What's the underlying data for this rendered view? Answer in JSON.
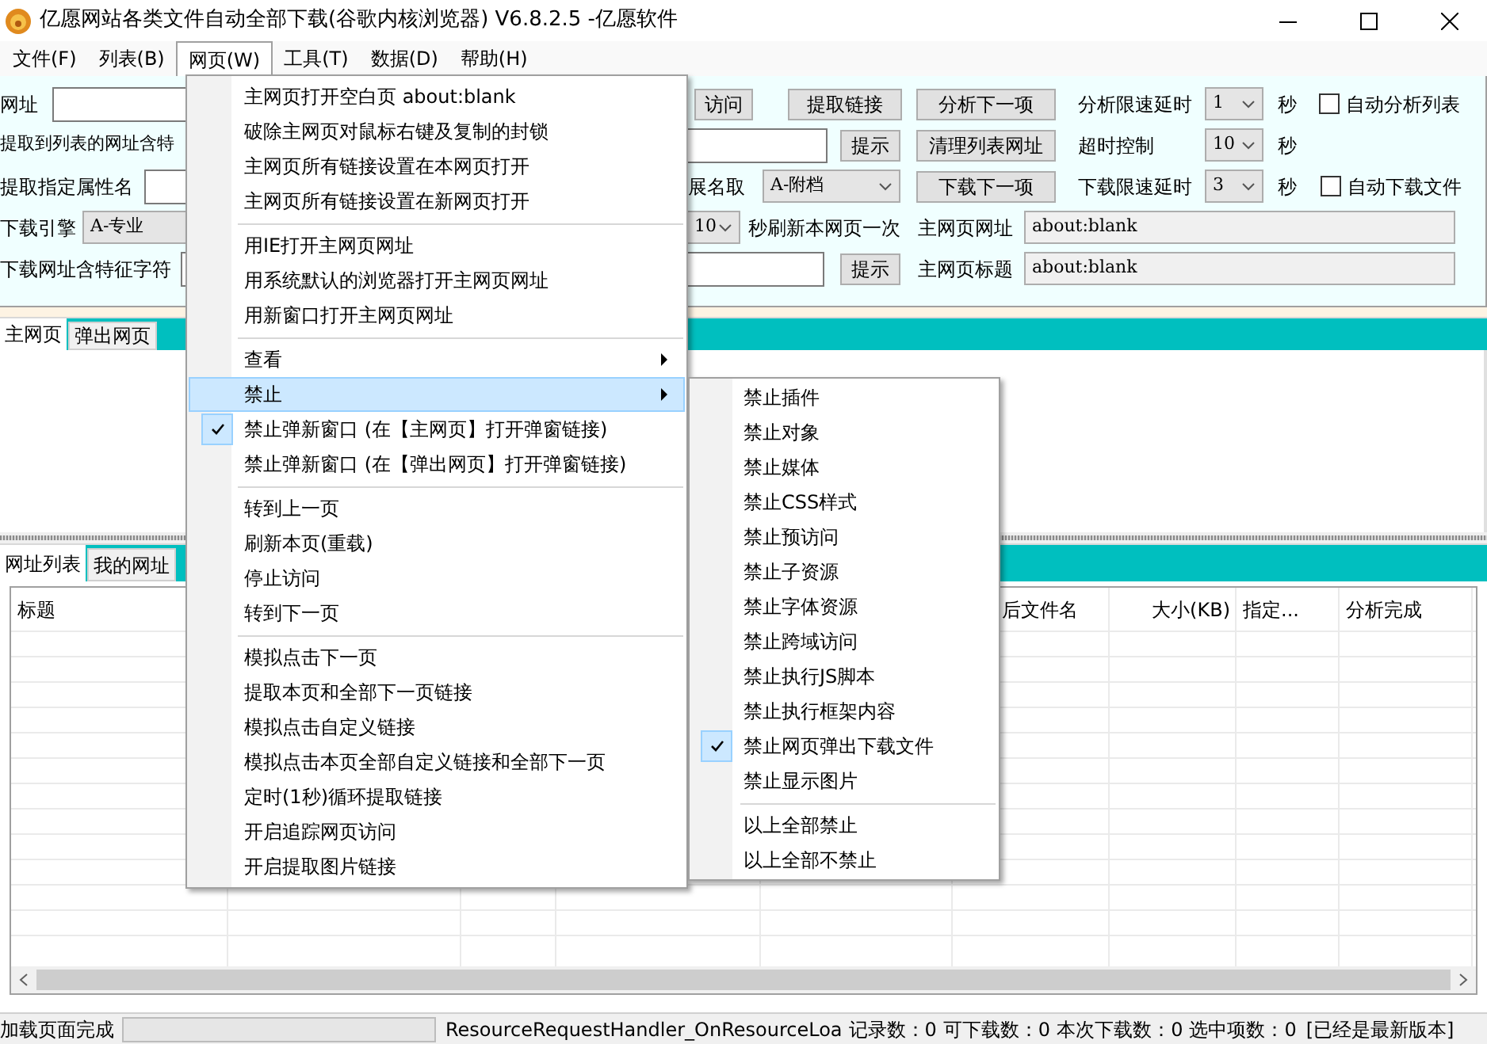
{
  "window": {
    "title": "亿愿网站各类文件自动全部下载(谷歌内核浏览器) V6.8.2.5 -亿愿软件"
  },
  "menu_bar": [
    {
      "label": "文件(F)",
      "selected": false
    },
    {
      "label": "列表(B)",
      "selected": false
    },
    {
      "label": "网页(W)",
      "selected": true
    },
    {
      "label": "工具(T)",
      "selected": false
    },
    {
      "label": "数据(D)",
      "selected": false
    },
    {
      "label": "帮助(H)",
      "selected": false
    }
  ],
  "toolbar": {
    "row1": {
      "url_label": "网址",
      "visit": "访问",
      "extract": "提取链接",
      "analyze_next": "分析下一项",
      "delay_label": "分析限速延时",
      "delay": "1",
      "unit": "秒",
      "auto_analyze": {
        "label": "自动分析列表",
        "checked": false
      }
    },
    "row2": {
      "label": "提取到列表的网址含特",
      "hint": "提示",
      "clean": "清理列表网址",
      "timeout_label": "超时控制",
      "timeout": "10",
      "unit": "秒"
    },
    "row3": {
      "label": "提取指定属性名",
      "ext_label": "展名取",
      "ext": "A-附档",
      "download_next": "下载下一项",
      "delay_label": "下载限速延时",
      "delay": "3",
      "unit": "秒",
      "auto_download": {
        "label": "自动下载文件",
        "checked": false
      }
    },
    "row4": {
      "label": "下载引擎",
      "engine": "A-专业",
      "refresh": "10",
      "refresh_label": "秒刷新本网页一次",
      "url_label": "主网页网址",
      "url": "about:blank"
    },
    "row5": {
      "label": "下载网址含特征字符",
      "hint": "提示",
      "title_label": "主网页标题",
      "title": "about:blank"
    }
  },
  "browser_tabs": [
    {
      "label": "主网页",
      "selected": true
    },
    {
      "label": "弹出网页",
      "selected": false
    }
  ],
  "list_tabs": [
    {
      "label": "网址列表",
      "selected": true
    },
    {
      "label": "我的网址",
      "selected": false
    }
  ],
  "table": {
    "columns": [
      "标题",
      "后文件名",
      "大小(KB)",
      "指定...",
      "分析完成"
    ]
  },
  "status_bar": {
    "message": "加载页面完成",
    "progress": {
      "level": 0
    },
    "event": "ResourceRequestHandler_OnResourceLoa",
    "counts": [
      "记录数：0",
      "可下载数：0",
      "本次下载数：0",
      "选中项数：0"
    ],
    "version": "[已经是最新版本]"
  },
  "menu": {
    "items": [
      {
        "kind": "item",
        "label": "主网页打开空白页 about:blank",
        "checked": false,
        "selected": false,
        "submenu": false
      },
      {
        "kind": "item",
        "label": "破除主网页对鼠标右键及复制的封锁",
        "checked": false,
        "selected": false,
        "submenu": false
      },
      {
        "kind": "item",
        "label": "主网页所有链接设置在本网页打开",
        "checked": false,
        "selected": false,
        "submenu": false
      },
      {
        "kind": "item",
        "label": "主网页所有链接设置在新网页打开",
        "checked": false,
        "selected": false,
        "submenu": false
      },
      {
        "kind": "separator"
      },
      {
        "kind": "item",
        "label": "用IE打开主网页网址",
        "checked": false,
        "selected": false,
        "submenu": false
      },
      {
        "kind": "item",
        "label": "用系统默认的浏览器打开主网页网址",
        "checked": false,
        "selected": false,
        "submenu": false
      },
      {
        "kind": "item",
        "label": "用新窗口打开主网页网址",
        "checked": false,
        "selected": false,
        "submenu": false
      },
      {
        "kind": "separator"
      },
      {
        "kind": "item",
        "label": "查看",
        "checked": false,
        "selected": false,
        "submenu": true
      },
      {
        "kind": "item",
        "label": "禁止",
        "checked": false,
        "selected": true,
        "submenu": true
      },
      {
        "kind": "item",
        "label": "禁止弹新窗口 (在【主网页】打开弹窗链接)",
        "checked": true,
        "selected": false,
        "submenu": false
      },
      {
        "kind": "item",
        "label": "禁止弹新窗口 (在【弹出网页】打开弹窗链接)",
        "checked": false,
        "selected": false,
        "submenu": false
      },
      {
        "kind": "separator"
      },
      {
        "kind": "item",
        "label": "转到上一页",
        "checked": false,
        "selected": false,
        "submenu": false
      },
      {
        "kind": "item",
        "label": "刷新本页(重载)",
        "checked": false,
        "selected": false,
        "submenu": false
      },
      {
        "kind": "item",
        "label": "停止访问",
        "checked": false,
        "selected": false,
        "submenu": false
      },
      {
        "kind": "item",
        "label": "转到下一页",
        "checked": false,
        "selected": false,
        "submenu": false
      },
      {
        "kind": "separator"
      },
      {
        "kind": "item",
        "label": "模拟点击下一页",
        "checked": false,
        "selected": false,
        "submenu": false
      },
      {
        "kind": "item",
        "label": "提取本页和全部下一页链接",
        "checked": false,
        "selected": false,
        "submenu": false
      },
      {
        "kind": "item",
        "label": "模拟点击自定义链接",
        "checked": false,
        "selected": false,
        "submenu": false
      },
      {
        "kind": "item",
        "label": "模拟点击本页全部自定义链接和全部下一页",
        "checked": false,
        "selected": false,
        "submenu": false
      },
      {
        "kind": "item",
        "label": "定时(1秒)循环提取链接",
        "checked": false,
        "selected": false,
        "submenu": false
      },
      {
        "kind": "item",
        "label": "开启追踪网页访问",
        "checked": false,
        "selected": false,
        "submenu": false
      },
      {
        "kind": "item",
        "label": "开启提取图片链接",
        "checked": false,
        "selected": false,
        "submenu": false
      }
    ]
  },
  "submenu": {
    "items": [
      {
        "kind": "item",
        "label": "禁止插件",
        "checked": false
      },
      {
        "kind": "item",
        "label": "禁止对象",
        "checked": false
      },
      {
        "kind": "item",
        "label": "禁止媒体",
        "checked": false
      },
      {
        "kind": "item",
        "label": "禁止CSS样式",
        "checked": false
      },
      {
        "kind": "item",
        "label": "禁止预访问",
        "checked": false
      },
      {
        "kind": "item",
        "label": "禁止子资源",
        "checked": false
      },
      {
        "kind": "item",
        "label": "禁止字体资源",
        "checked": false
      },
      {
        "kind": "item",
        "label": "禁止跨域访问",
        "checked": false
      },
      {
        "kind": "item",
        "label": "禁止执行JS脚本",
        "checked": false
      },
      {
        "kind": "item",
        "label": "禁止执行框架内容",
        "checked": false
      },
      {
        "kind": "item",
        "label": "禁止网页弹出下载文件",
        "checked": true
      },
      {
        "kind": "item",
        "label": "禁止显示图片",
        "checked": false
      },
      {
        "kind": "separator"
      },
      {
        "kind": "item",
        "label": "以上全部禁止",
        "checked": false
      },
      {
        "kind": "item",
        "label": "以上全部不禁止",
        "checked": false
      }
    ]
  }
}
